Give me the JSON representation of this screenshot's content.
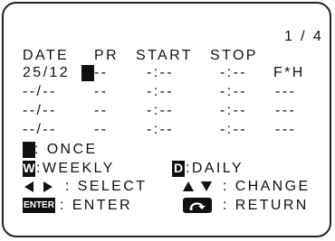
{
  "page_indicator": "1 / 4",
  "headers": {
    "date": "DATE",
    "pr": "PR",
    "start": "START",
    "stop": "STOP"
  },
  "rows": [
    {
      "date": "25/12",
      "pr": "--",
      "start": "-:--",
      "stop": "-:--",
      "mode": "F*H"
    },
    {
      "date": "--/--",
      "pr": "--",
      "start": "-:--",
      "stop": "-:--",
      "mode": "---"
    },
    {
      "date": "--/--",
      "pr": "--",
      "start": "-:--",
      "stop": "-:--",
      "mode": "---"
    },
    {
      "date": "--/--",
      "pr": "--",
      "start": "-:--",
      "stop": "-:--",
      "mode": "---"
    }
  ],
  "legend": {
    "once": ": ONCE",
    "weekly_key": "W",
    "weekly": ":WEEKLY",
    "daily_key": "D",
    "daily": ":DAILY",
    "select": ": SELECT",
    "change": ": CHANGE",
    "enter_key": "ENTER",
    "enter": ": ENTER",
    "return": ": RETURN"
  }
}
